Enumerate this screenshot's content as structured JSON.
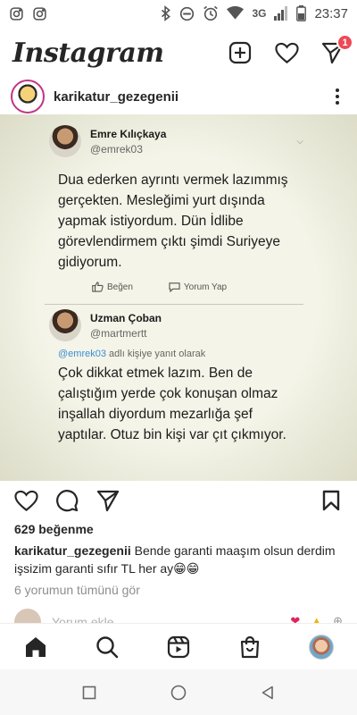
{
  "status_bar": {
    "network_label": "3G",
    "time": "23:37"
  },
  "header": {
    "logo": "Instagram",
    "notification_count": "1"
  },
  "post": {
    "username": "karikatur_gezegenii",
    "tweets": [
      {
        "name": "Emre Kılıçkaya",
        "handle": "@emrek03",
        "text": "Dua ederken ayrıntı vermek lazımmış gerçekten. Mesleğimi yurt dışında yapmak istiyordum. Dün İdlibe görevlendirmem çıktı şimdi Suriyeye gidiyorum.",
        "like_label": "Beğen",
        "reply_label": "Yorum Yap"
      },
      {
        "name": "Uzman Çoban",
        "handle": "@martmertt",
        "reply_handle": "@emrek03",
        "reply_suffix": "adlı kişiye yanıt olarak",
        "text": "Çok dikkat etmek lazım. Ben de çalıştığım yerde çok konuşan olmaz inşallah diyordum mezarlığa şef yaptılar. Otuz bin kişi var çıt çıkmıyor."
      }
    ],
    "likes": "629 beğenme",
    "caption_user": "karikatur_gezegenii",
    "caption_text": "Bende garanti maaşım olsun derdim işsizim garanti sıfır TL her ay😁😁",
    "view_comments": "6 yorumun tümünü gör",
    "comment_placeholder": "Yorum ekle..."
  },
  "colors": {
    "badge": "#ed4956",
    "text": "#262626",
    "muted": "#8e8e8e",
    "link": "#3b8ed6"
  }
}
